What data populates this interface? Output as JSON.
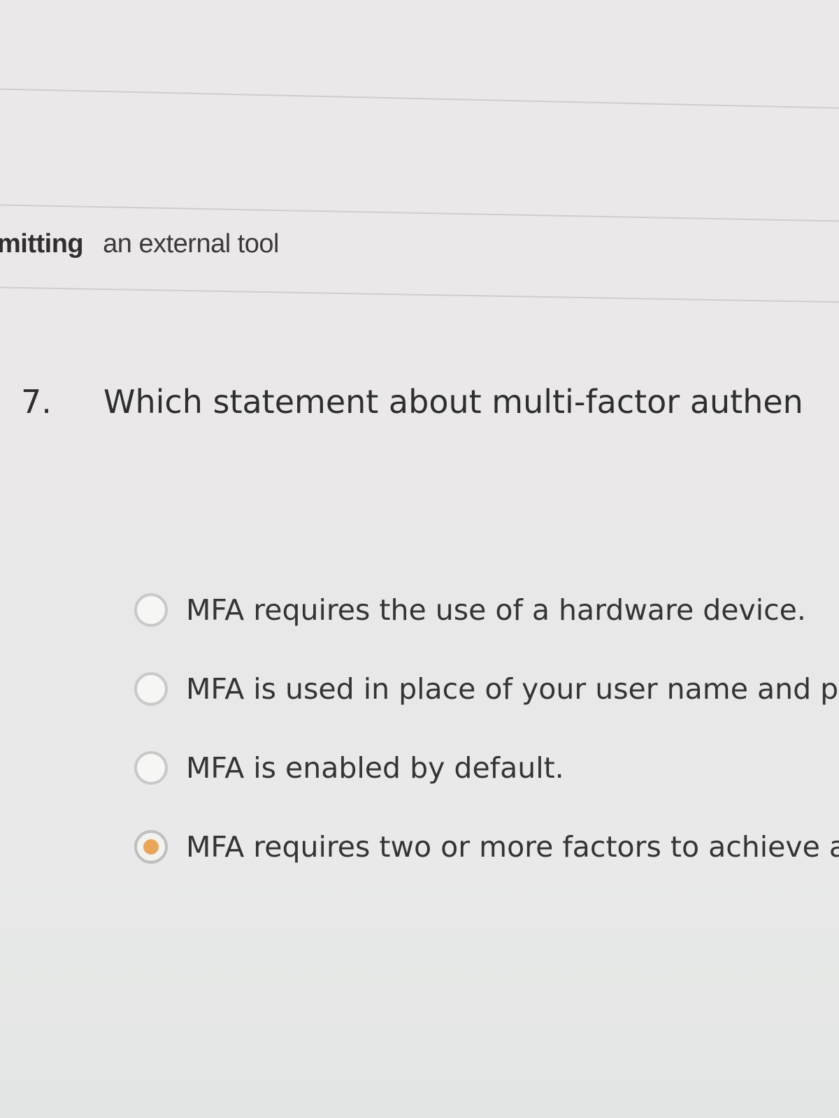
{
  "previous_question": {
    "answer_part_bold": "mitting",
    "answer_part": "an external tool"
  },
  "question": {
    "number": "7.",
    "text": "Which statement about multi-factor authen"
  },
  "options": [
    {
      "label": "MFA requires the use of a hardware device.",
      "selected": false
    },
    {
      "label": "MFA is used in place of your user name and pa",
      "selected": false
    },
    {
      "label": "MFA is enabled by default.",
      "selected": false
    },
    {
      "label": "MFA requires two or more factors to achieve a",
      "selected": true
    }
  ],
  "colors": {
    "radio_selected": "#e8a65a",
    "radio_border": "#c9c9c9",
    "text": "#333333"
  }
}
